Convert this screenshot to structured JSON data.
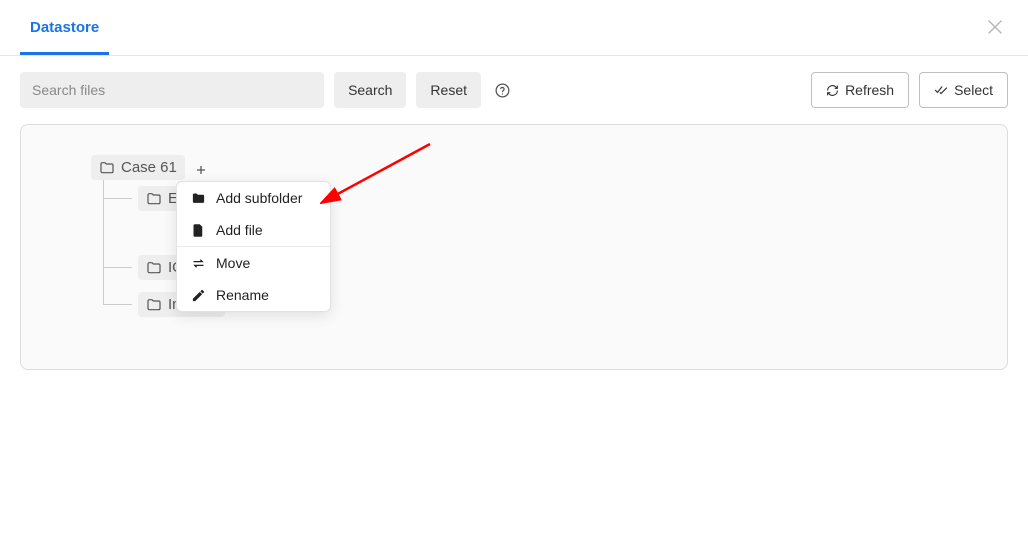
{
  "tabs": {
    "datastore": "Datastore"
  },
  "toolbar": {
    "search_placeholder": "Search files",
    "search_label": "Search",
    "reset_label": "Reset",
    "refresh_label": "Refresh",
    "select_label": "Select"
  },
  "tree": {
    "root": {
      "label": "Case 61"
    },
    "child_ev": {
      "label": "Ev"
    },
    "child_io": {
      "label": "IO"
    },
    "child_images": {
      "label": "Images"
    }
  },
  "context_menu": {
    "add_subfolder": "Add subfolder",
    "add_file": "Add file",
    "move": "Move",
    "rename": "Rename"
  }
}
